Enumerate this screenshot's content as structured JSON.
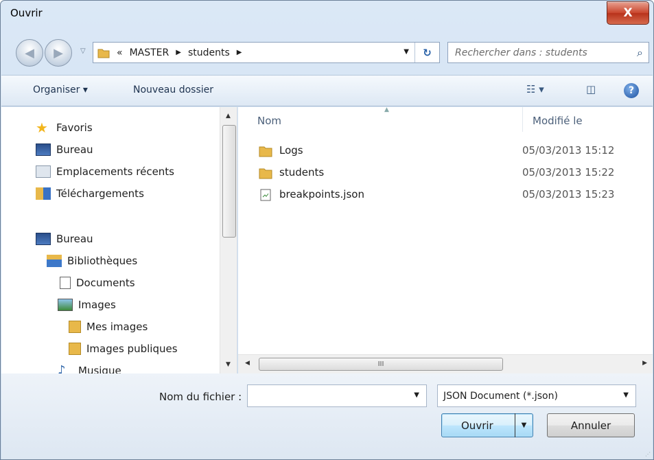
{
  "window": {
    "title": "Ouvrir",
    "close_glyph": "X"
  },
  "nav": {
    "breadcrumbs": [
      "«",
      "MASTER",
      "students"
    ],
    "search_placeholder": "Rechercher dans : students"
  },
  "toolbar": {
    "organize": "Organiser ▾",
    "new_folder": "Nouveau dossier",
    "help_glyph": "?"
  },
  "sidebar": {
    "items": [
      {
        "label": "Favoris",
        "icon": "star-icon"
      },
      {
        "label": "Bureau",
        "icon": "desktop-icon"
      },
      {
        "label": "Emplacements récents",
        "icon": "recent-places-icon"
      },
      {
        "label": "Téléchargements",
        "icon": "downloads-icon"
      },
      {
        "label": "Bureau",
        "icon": "desktop-icon"
      },
      {
        "label": "Bibliothèques",
        "icon": "libraries-icon"
      },
      {
        "label": "Documents",
        "icon": "documents-icon"
      },
      {
        "label": "Images",
        "icon": "images-icon"
      },
      {
        "label": "Mes images",
        "icon": "folder-icon"
      },
      {
        "label": "Images publiques",
        "icon": "folder-icon"
      },
      {
        "label": "Musique",
        "icon": "music-icon"
      }
    ]
  },
  "files": {
    "col_name": "Nom",
    "col_modified": "Modifié le",
    "rows": [
      {
        "name": "Logs",
        "date": "05/03/2013 15:12",
        "icon": "folder-icon"
      },
      {
        "name": "students",
        "date": "05/03/2013 15:22",
        "icon": "folder-icon"
      },
      {
        "name": "breakpoints.json",
        "date": "05/03/2013 15:23",
        "icon": "json-file-icon"
      }
    ]
  },
  "bottom": {
    "filename_label": "Nom du fichier :",
    "filename_value": "",
    "filetype": "JSON Document (*.json)",
    "open": "Ouvrir",
    "cancel": "Annuler"
  },
  "colors": {
    "accent": "#2a62a8",
    "close": "#c9452d",
    "folder": "#e8b84a"
  }
}
